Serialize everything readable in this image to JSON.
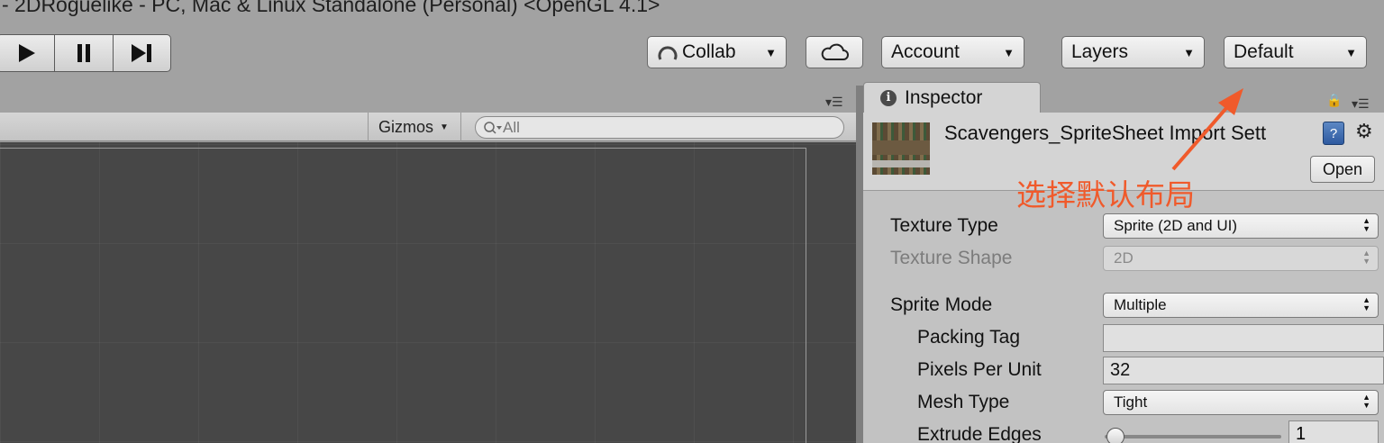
{
  "window": {
    "title": "- 2DRoguelike - PC, Mac & Linux Standalone (Personal) <OpenGL 4.1>"
  },
  "toolbar": {
    "play_icon": "play-icon",
    "pause_icon": "pause-icon",
    "step_icon": "step-icon",
    "collab_label": "Collab",
    "collab_caret": "▾",
    "cloud_icon": "cloud-icon",
    "account_label": "Account",
    "layers_label": "Layers",
    "layout_label": "Default"
  },
  "scene": {
    "gizmos_label": "Gizmos",
    "search_placeholder": "All"
  },
  "inspector": {
    "tab_label": "Inspector",
    "asset_name": "Scavengers_SpriteSheet Import Sett",
    "open_label": "Open",
    "properties": {
      "texture_type": {
        "label": "Texture Type",
        "value": "Sprite (2D and UI)"
      },
      "texture_shape": {
        "label": "Texture Shape",
        "value": "2D"
      },
      "sprite_mode": {
        "label": "Sprite Mode",
        "value": "Multiple"
      },
      "packing_tag": {
        "label": "Packing Tag",
        "value": ""
      },
      "pixels_per_unit": {
        "label": "Pixels Per Unit",
        "value": "32"
      },
      "mesh_type": {
        "label": "Mesh Type",
        "value": "Tight"
      },
      "extrude_edges": {
        "label": "Extrude Edges",
        "value": "1",
        "slider_fraction": 0.03
      }
    }
  },
  "annotation": {
    "text": "选择默认布局",
    "color": "#f05a2b"
  },
  "colors": {
    "toolbar_bg": "#a2a2a2",
    "scene_bg": "#474747",
    "inspector_bg": "#c2c2c2",
    "accent": "#f05a2b"
  }
}
